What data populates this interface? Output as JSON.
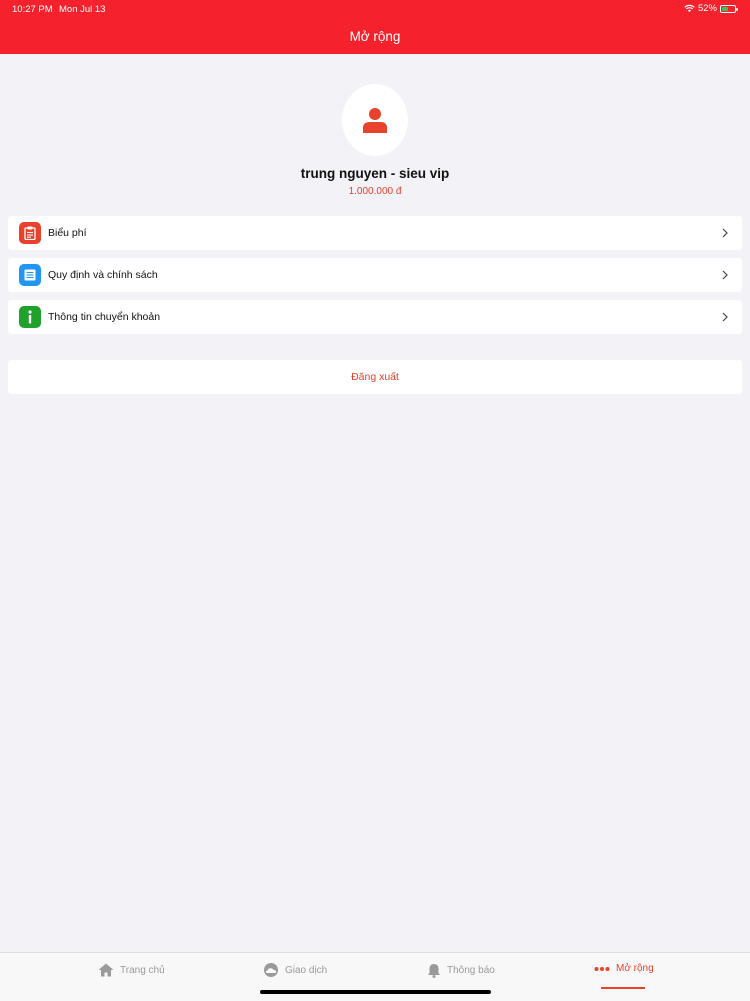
{
  "status_bar": {
    "time": "10:27 PM",
    "date": "Mon Jul 13",
    "battery": "52%",
    "battery_level": 0.52
  },
  "header": {
    "title": "Mở rộng"
  },
  "profile": {
    "name": "trung nguyen - sieu vip",
    "balance": "1.000.000 đ"
  },
  "menu": {
    "items": [
      {
        "label": "Biểu phí",
        "icon": "clipboard-icon",
        "color": "#e8412c"
      },
      {
        "label": "Quy định và chính sách",
        "icon": "document-icon",
        "color": "#2196f3"
      },
      {
        "label": "Thông tin chuyển khoản",
        "icon": "info-icon",
        "color": "#1fa12c"
      }
    ]
  },
  "logout": {
    "label": "Đăng xuất"
  },
  "tabbar": {
    "tabs": [
      {
        "label": "Trang chủ",
        "icon": "home-icon"
      },
      {
        "label": "Giao dịch",
        "icon": "cloud-icon"
      },
      {
        "label": "Thông báo",
        "icon": "bell-icon"
      },
      {
        "label": "Mở rộng",
        "icon": "more-dots-icon",
        "active": true
      }
    ]
  },
  "colors": {
    "header": "#f5222d",
    "accent": "#e8412c",
    "background": "#f2f2f7"
  }
}
